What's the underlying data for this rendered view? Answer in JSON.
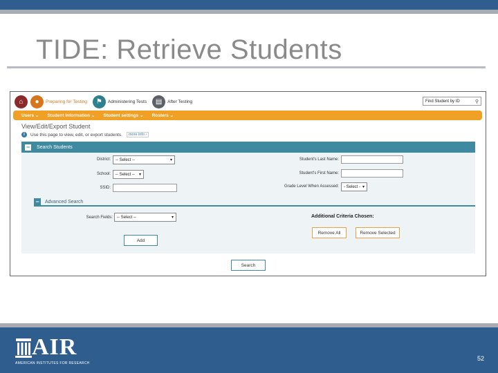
{
  "slide": {
    "title": "TIDE: Retrieve Students",
    "page_number": "52",
    "logo_text": "AIR",
    "logo_subtitle": "AMERICAN INSTITUTES FOR RESEARCH",
    "colors": {
      "header_blue": "#2e5d8e",
      "accent_gray": "#a7acb4",
      "title_gray": "#8a8a8a"
    }
  },
  "app": {
    "top_nav": {
      "items": [
        {
          "label": "",
          "icon": "home-icon"
        },
        {
          "label": "Preparing for Testing",
          "icon": "user-icon"
        },
        {
          "label": "Administering Tests",
          "icon": "admin-icon"
        },
        {
          "label": "After Testing",
          "icon": "clipboard-icon"
        }
      ],
      "find_placeholder": "Find Student by ID"
    },
    "menu": [
      "Users",
      "Student Information",
      "Student settings",
      "Rosters"
    ],
    "page_heading": "View/Edit/Export Student",
    "help_text": "Use this page to view, edit, or export students.",
    "more_info": "more info",
    "search_panel": {
      "title": "Search Students",
      "district_label": "District:",
      "district_value": "-- Select --",
      "school_label": "School:",
      "school_value": "-- Select --",
      "ssid_label": "SSID:",
      "last_name_label": "Student's Last Name:",
      "first_name_label": "Student's First Name:",
      "grade_label": "Grade Level When Assessed:",
      "grade_value": "- Select -"
    },
    "advanced": {
      "title": "Advanced Search",
      "search_fields_label": "Search Fields:",
      "search_fields_value": "-- Select --",
      "add_label": "Add",
      "criteria_title": "Additional Criteria Chosen:",
      "remove_all": "Remove All",
      "remove_selected": "Remove Selected"
    },
    "search_button": "Search",
    "colors": {
      "orange": "#f0a024",
      "teal": "#3f8aa0"
    }
  }
}
